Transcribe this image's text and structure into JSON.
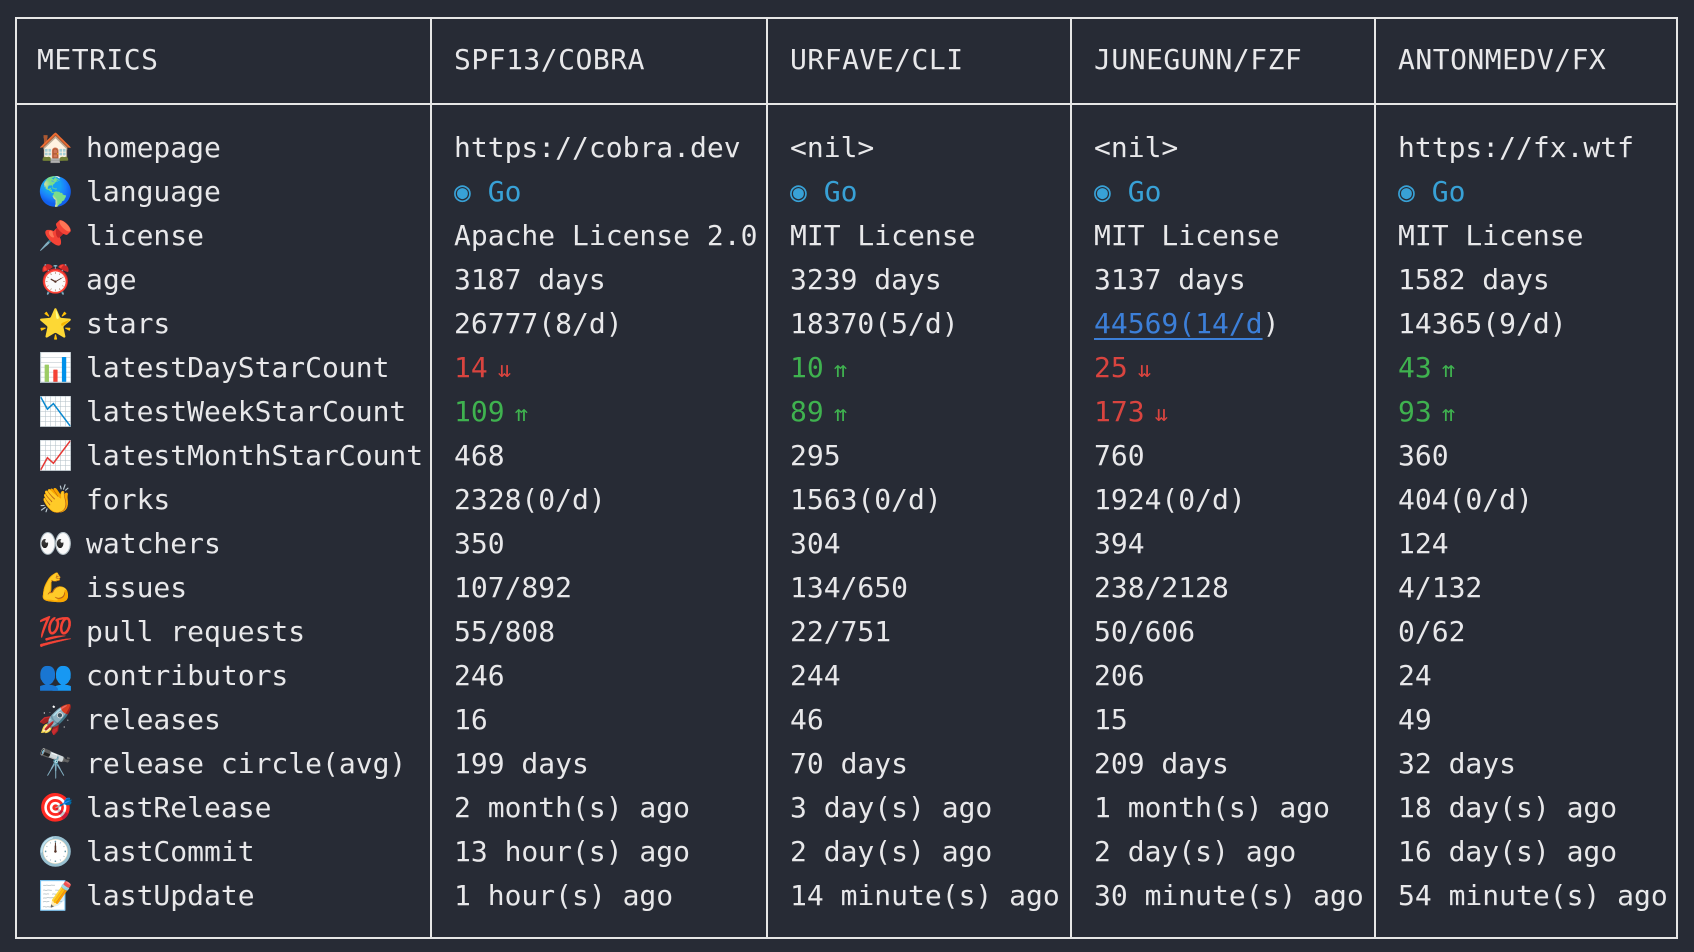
{
  "headers": {
    "metrics": "METRICS",
    "col1": "SPF13/COBRA",
    "col2": "URFAVE/CLI",
    "col3": "JUNEGUNN/FZF",
    "col4": "ANTONMEDV/FX"
  },
  "colors": {
    "background": "#272b35",
    "border": "#e6e6e6",
    "text": "#e8e8ea",
    "go_blue": "#38a1d6",
    "up_green": "#3fb24f",
    "down_red": "#d9443f",
    "link_blue": "#3c7fd8"
  },
  "rows": [
    {
      "icon": "house-icon",
      "glyph": "🏠",
      "label": "homepage",
      "values": [
        "https://cobra.dev",
        "<nil>",
        "<nil>",
        "https://fx.wtf"
      ]
    },
    {
      "icon": "globe-icon",
      "glyph": "🌎",
      "label": "language",
      "values": [
        "Go",
        "Go",
        "Go",
        "Go"
      ],
      "prefix": "◉"
    },
    {
      "icon": "pushpin-icon",
      "glyph": "📌",
      "label": "license",
      "values": [
        "Apache License 2.0",
        "MIT License",
        "MIT License",
        "MIT License"
      ]
    },
    {
      "icon": "alarm-clock-icon",
      "glyph": "⏰",
      "label": "age",
      "values": [
        "3187 days",
        "3239 days",
        "3137 days",
        "1582 days"
      ]
    },
    {
      "icon": "glowing-star-icon",
      "glyph": "🌟",
      "label": "stars",
      "values": [
        "26777(8/d)",
        "18370(5/d)",
        "44569(14/d)",
        "14365(9/d)"
      ]
    },
    {
      "icon": "bar-chart-icon",
      "glyph": "📊",
      "label": "latestDayStarCount",
      "values": [
        "14",
        "10",
        "25",
        "43"
      ],
      "trend": [
        "down",
        "up",
        "down",
        "up"
      ]
    },
    {
      "icon": "chart-decreasing-icon",
      "glyph": "📉",
      "label": "latestWeekStarCount",
      "values": [
        "109",
        "89",
        "173",
        "93"
      ],
      "trend": [
        "up",
        "up",
        "down",
        "up"
      ]
    },
    {
      "icon": "chart-increasing-icon",
      "glyph": "📈",
      "label": "latestMonthStarCount",
      "values": [
        "468",
        "295",
        "760",
        "360"
      ]
    },
    {
      "icon": "clapping-hands-icon",
      "glyph": "👏",
      "label": "forks",
      "values": [
        "2328(0/d)",
        "1563(0/d)",
        "1924(0/d)",
        "404(0/d)"
      ]
    },
    {
      "icon": "eyes-icon",
      "glyph": "👀",
      "label": "watchers",
      "values": [
        "350",
        "304",
        "394",
        "124"
      ]
    },
    {
      "icon": "flexed-biceps-icon",
      "glyph": "💪",
      "label": "issues",
      "values": [
        "107/892",
        "134/650",
        "238/2128",
        "4/132"
      ]
    },
    {
      "icon": "hundred-points-icon",
      "glyph": "💯",
      "label": "pull requests",
      "values": [
        "55/808",
        "22/751",
        "50/606",
        "0/62"
      ]
    },
    {
      "icon": "busts-icon",
      "glyph": "👥",
      "label": "contributors",
      "values": [
        "246",
        "244",
        "206",
        "24"
      ]
    },
    {
      "icon": "rocket-icon",
      "glyph": "🚀",
      "label": "releases",
      "values": [
        "16",
        "46",
        "15",
        "49"
      ]
    },
    {
      "icon": "telescope-icon",
      "glyph": "🔭",
      "label": "release circle(avg)",
      "values": [
        "199 days",
        "70 days",
        "209 days",
        "32 days"
      ]
    },
    {
      "icon": "direct-hit-icon",
      "glyph": "🎯",
      "label": "lastRelease",
      "values": [
        "2 month(s) ago",
        "3 day(s) ago",
        "1 month(s) ago",
        "18 day(s) ago"
      ]
    },
    {
      "icon": "clock-icon",
      "glyph": "🕛",
      "label": "lastCommit",
      "values": [
        "13 hour(s) ago",
        "2 day(s) ago",
        "2 day(s) ago",
        "16 day(s) ago"
      ]
    },
    {
      "icon": "memo-icon",
      "glyph": "📝",
      "label": "lastUpdate",
      "values": [
        "1 hour(s) ago",
        "14 minute(s) ago",
        "30 minute(s) ago",
        "54 minute(s) ago"
      ]
    }
  ],
  "trend_glyphs": {
    "up": "⇈",
    "down": "⇊"
  },
  "stars_link_suffix": ")"
}
